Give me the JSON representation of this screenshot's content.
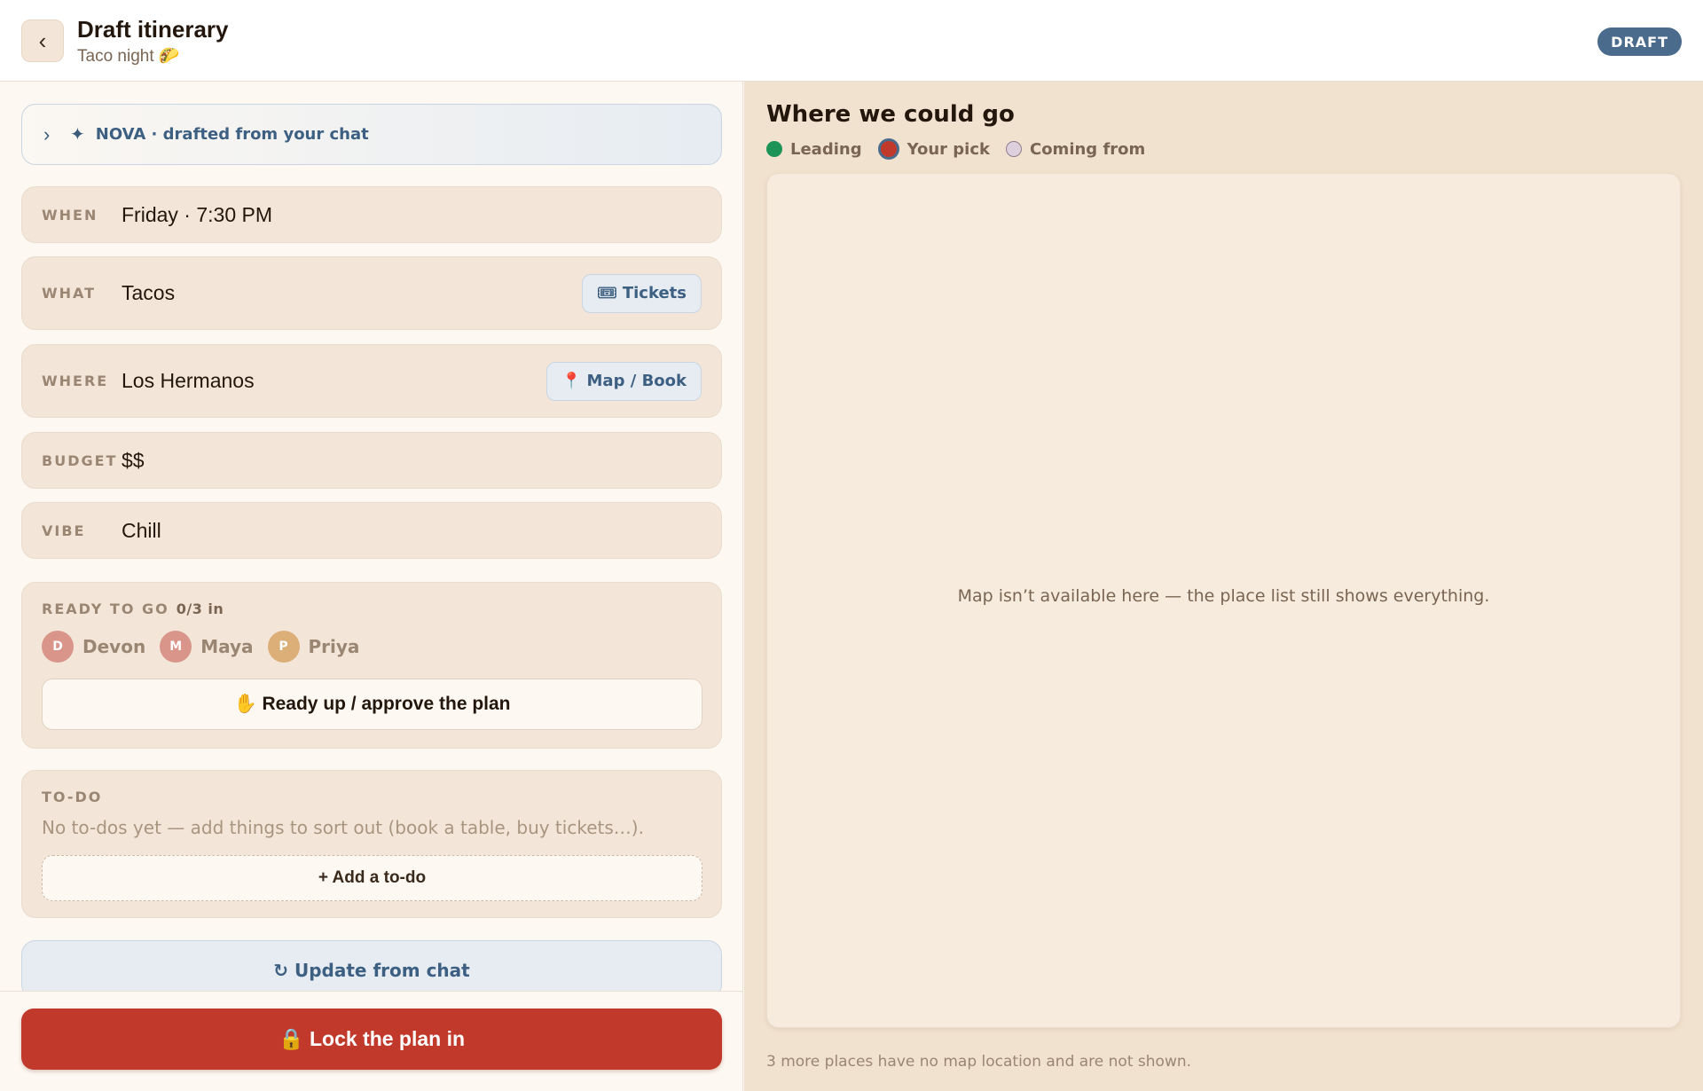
{
  "header": {
    "back_label": "‹",
    "title": "Draft itinerary",
    "subtitle": "Taco night 🌮",
    "badge": "DRAFT"
  },
  "nova": {
    "chevron": "›",
    "sparkle": "✦",
    "text": "NOVA · drafted from your chat"
  },
  "fields": {
    "when": {
      "label": "WHEN",
      "value": "Friday · 7:30 PM"
    },
    "what": {
      "label": "WHAT",
      "value": "Tacos",
      "button": "Tickets",
      "button_icon": "🎟"
    },
    "where": {
      "label": "WHERE",
      "value": "Los Hermanos",
      "button": "Map / Book",
      "button_icon": "📍"
    },
    "budget": {
      "label": "BUDGET",
      "value": "$$"
    },
    "vibe": {
      "label": "VIBE",
      "value": "Chill"
    }
  },
  "ready": {
    "label": "READY TO GO",
    "count": "0/3 in",
    "people": [
      {
        "initial": "D",
        "name": "Devon",
        "color": "#d9958a"
      },
      {
        "initial": "M",
        "name": "Maya",
        "color": "#d9958a"
      },
      {
        "initial": "P",
        "name": "Priya",
        "color": "#dcae78"
      }
    ],
    "button": "✋ Ready up / approve the plan"
  },
  "todo": {
    "label": "TO-DO",
    "empty": "No to-dos yet — add things to sort out (book a table, buy tickets…).",
    "add": "+ Add a to-do"
  },
  "update_button": "↻ Update from chat",
  "lock_button": "🔒 Lock the plan in",
  "map": {
    "title": "Where we could go",
    "legend": [
      {
        "key": "lead",
        "label": "Leading",
        "color": "#1d9457"
      },
      {
        "key": "pick",
        "label": "Your pick",
        "color": "#c0392b"
      },
      {
        "key": "from",
        "label": "Coming from",
        "color": "#ddd0dc"
      }
    ],
    "unavailable": "Map isn’t available here — the place list still shows everything.",
    "note": "3 more places have no map location and are not shown."
  },
  "colors": {
    "accent_red": "#c0392b",
    "accent_blue": "#4b6b8c",
    "surface": "#f3e6d8"
  }
}
